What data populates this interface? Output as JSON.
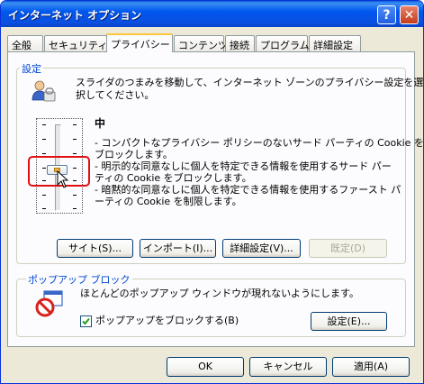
{
  "window": {
    "title": "インターネット オプション",
    "help": "?",
    "close": "✕"
  },
  "tabs": [
    "全般",
    "セキュリティ",
    "プライバシー",
    "コンテンツ",
    "接続",
    "プログラム",
    "詳細設定"
  ],
  "active_tab": "プライバシー",
  "settings": {
    "label": "設定",
    "description_lines": [
      "スライダのつまみを移動して、インターネット ゾーンのプライバシー設定を選",
      "択してください。"
    ],
    "level_title": "中",
    "level_desc_lines": [
      "- コンパクトなプライバシー ポリシーのないサード パーティの Cookie を",
      "ブロックします。",
      "- 明示的な同意なしに個人を特定できる情報を使用するサード パー",
      "ティの Cookie をブロックします。",
      "- 暗黙的な同意なしに個人を特定できる情報を使用するファースト パ",
      "ーティの Cookie を制限します。"
    ],
    "slider_level": 0.4,
    "buttons": {
      "site": "サイト(S)...",
      "import": "インポート(I)...",
      "advanced": "詳細設定(V)...",
      "default": "既定(D)"
    }
  },
  "popup": {
    "label": "ポップアップ ブロック",
    "description": "ほとんどのポップアップ ウィンドウが現れないようにします。",
    "checkbox_label": "ポップアップをブロックする(B)",
    "checkbox_checked": true,
    "settings_button": "設定(E)..."
  },
  "footer": {
    "ok": "OK",
    "cancel": "キャンセル",
    "apply": "適用(A)"
  },
  "colors": {
    "title_bar": "#0058ee",
    "group_label": "#0046d5",
    "highlight_box": "#e01010"
  }
}
